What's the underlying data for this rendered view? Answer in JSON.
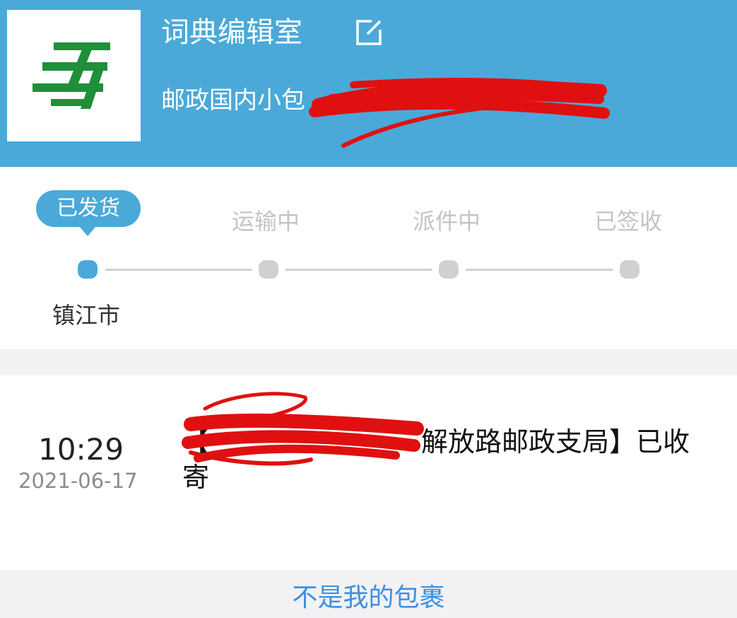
{
  "header": {
    "title": "词典编辑室",
    "subtitle": "邮政国内小包",
    "background_color": "#4aa9d8"
  },
  "progress": {
    "active_step": 0,
    "steps": [
      {
        "label": "已发货"
      },
      {
        "label": "运输中"
      },
      {
        "label": "派件中"
      },
      {
        "label": "已签收"
      }
    ],
    "current_city": "镇江市"
  },
  "record": {
    "time": "10:29",
    "date": "2021-06-17",
    "text_visible": "【",
    "text_visible_tail": "解放路邮政支局】已收寄"
  },
  "footer": {
    "link_label": "不是我的包裹"
  },
  "colors": {
    "accent": "#4aa9d8",
    "inactive": "#d0d0d0",
    "link": "#3d8fe0",
    "redaction": "#e01010"
  },
  "icons": {
    "logo": "china-post-logo",
    "edit": "edit-icon"
  }
}
